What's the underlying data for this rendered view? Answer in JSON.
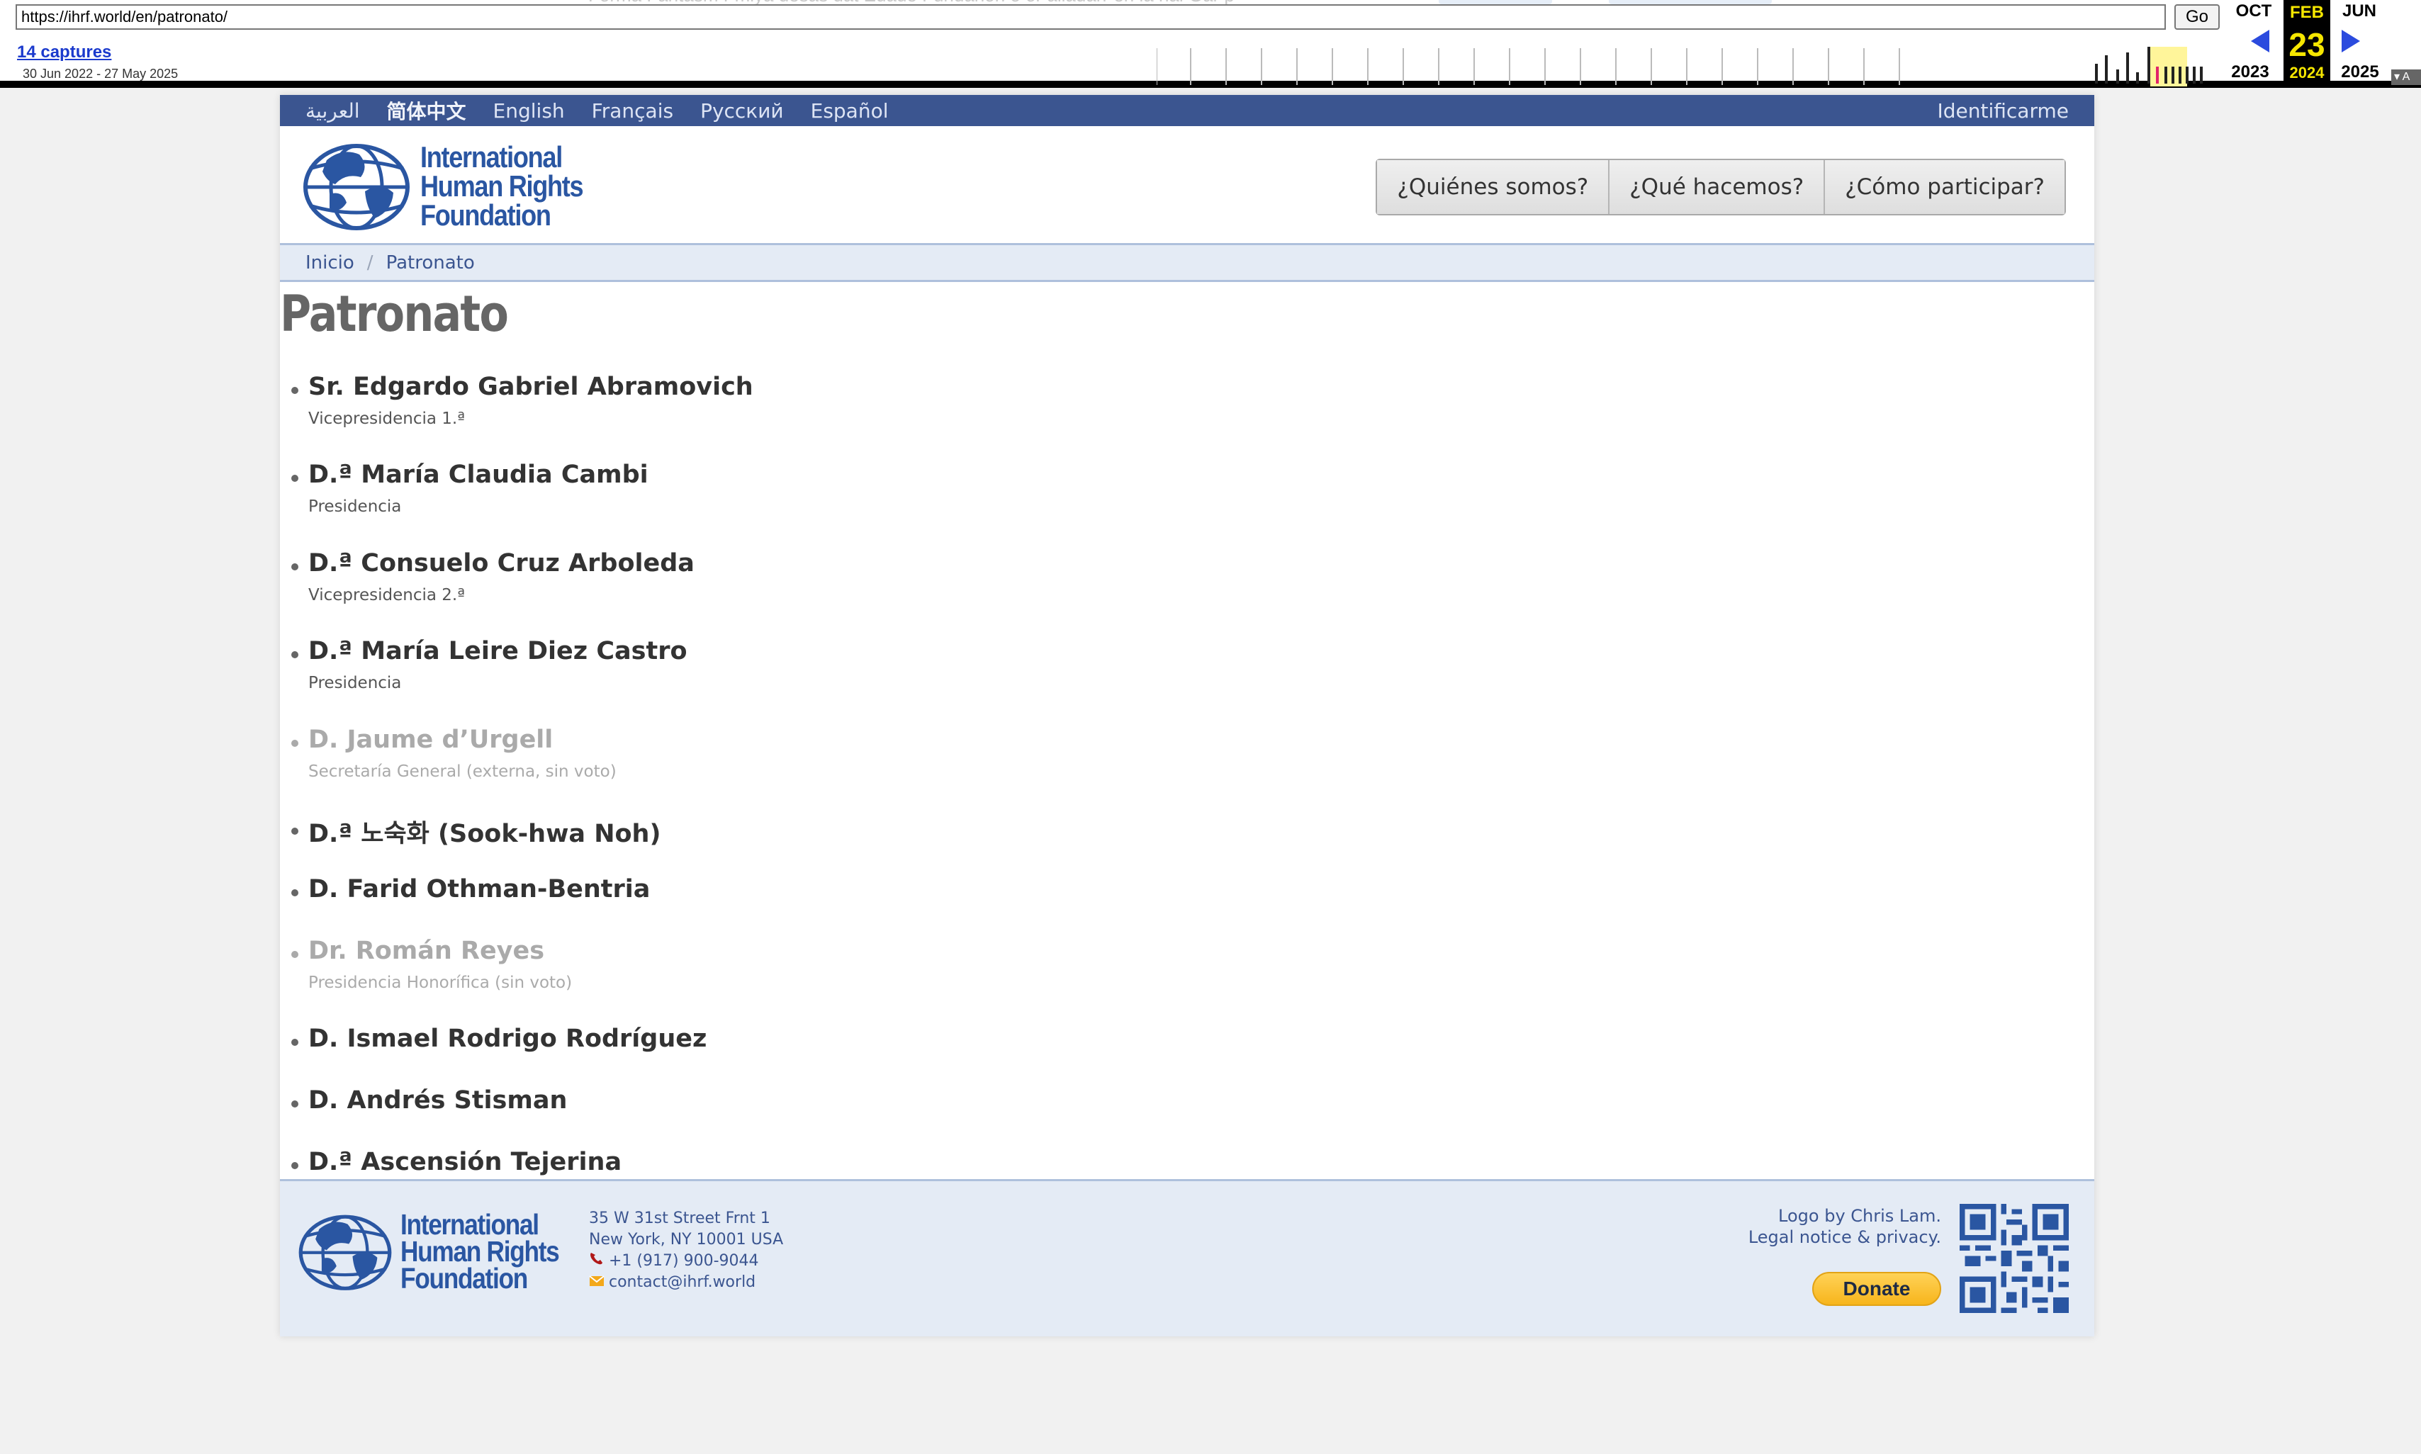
{
  "wayback": {
    "url": "https://ihrf.world/en/patronato/",
    "go_label": "Go",
    "captures_label": "14 captures",
    "date_range": "30 Jun 2022 - 27 May 2025",
    "prev_month": "OCT",
    "prev_year": "2023",
    "current_month": "FEB",
    "current_day": "23",
    "current_year": "2024",
    "next_month": "JUN",
    "next_year": "2025",
    "about_label": "A",
    "ghost_text": "Forma Fantasm Fmiya desas dat Edade Fundarion o or alladarr en la hal Gar p"
  },
  "site": {
    "languages": [
      "العربية",
      "简体中文",
      "English",
      "Français",
      "Русский",
      "Español"
    ],
    "login_label": "Identificarme",
    "logo_lines": [
      "International",
      "Human Rights",
      "Foundation"
    ],
    "nav": [
      "¿Quiénes somos?",
      "¿Qué hacemos?",
      "¿Cómo participar?"
    ],
    "breadcrumb": {
      "home": "Inicio",
      "separator": "/",
      "current": "Patronato"
    },
    "page_title": "Patronato",
    "members": [
      {
        "name": "Sr. Edgardo Gabriel Abramovich",
        "role": "Vicepresidencia 1.ª",
        "active": true
      },
      {
        "name": "D.ª María Claudia Cambi",
        "role": "Presidencia",
        "active": true
      },
      {
        "name": "D.ª Consuelo Cruz Arboleda",
        "role": "Vicepresidencia 2.ª",
        "active": true
      },
      {
        "name": "D.ª María Leire Diez Castro",
        "role": "Presidencia",
        "active": true
      },
      {
        "name": "D. Jaume d’Urgell",
        "role": "Secretaría General (externa, sin voto)",
        "active": false
      },
      {
        "name": "D.ª 노숙화 (Sook-hwa Noh)",
        "role": "",
        "active": true
      },
      {
        "name": "D. Farid Othman-Bentria",
        "role": "",
        "active": true
      },
      {
        "name": "Dr. Román Reyes",
        "role": "Presidencia Honorífica (sin voto)",
        "active": false
      },
      {
        "name": "D. Ismael Rodrigo Rodríguez",
        "role": "",
        "active": true
      },
      {
        "name": "D. Andrés Stisman",
        "role": "",
        "active": true
      },
      {
        "name": "D.ª Ascensión Tejerina",
        "role": "",
        "active": true
      }
    ],
    "footer": {
      "address_line1": "35 W 31st Street Frnt 1",
      "address_line2": "New York, NY 10001 USA",
      "phone": "+1 (917) 900-9044",
      "email": "contact@ihrf.world",
      "credit": "Logo by Chris Lam.",
      "legal": "Legal notice & privacy.",
      "donate_label": "Donate"
    },
    "colors": {
      "brand_blue": "#2a56a2",
      "lang_bar": "#3b5590",
      "pale_blue": "#e4ebf5",
      "inactive_gray": "#aaaaaa"
    }
  }
}
